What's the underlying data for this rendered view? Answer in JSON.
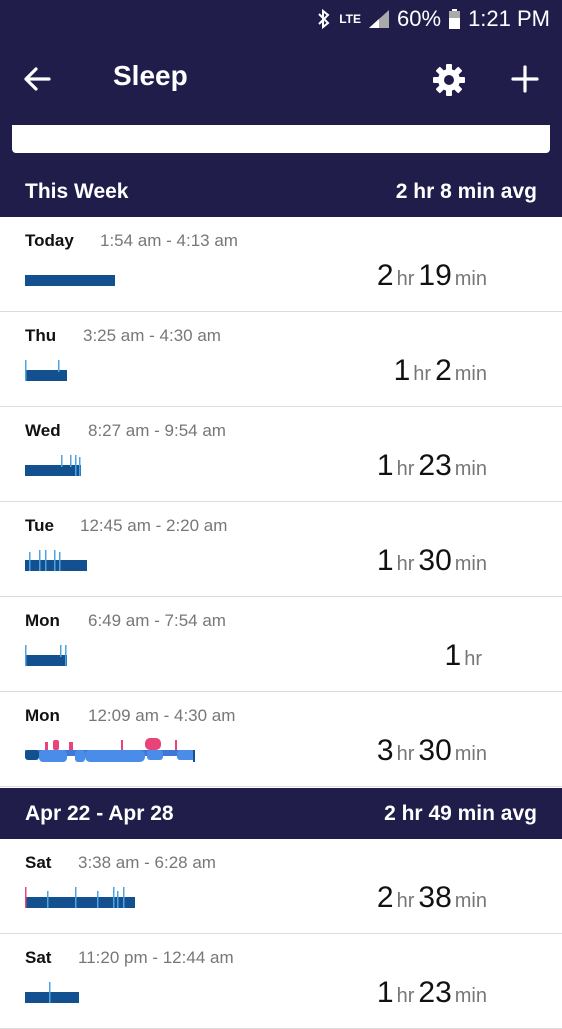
{
  "status_bar": {
    "network": "LTE",
    "battery": "60%",
    "clock": "1:21 PM"
  },
  "app_bar": {
    "title": "Sleep"
  },
  "sections": [
    {
      "label": "This Week",
      "avg": "2 hr 8 min avg",
      "rows": [
        {
          "day": "Today",
          "time": "1:54 am - 4:13 am",
          "hr": "2",
          "min": "19"
        },
        {
          "day": "Thu",
          "time": "3:25 am - 4:30 am",
          "hr": "1",
          "min": "2"
        },
        {
          "day": "Wed",
          "time": "8:27 am - 9:54 am",
          "hr": "1",
          "min": "23"
        },
        {
          "day": "Tue",
          "time": "12:45 am - 2:20 am",
          "hr": "1",
          "min": "30"
        },
        {
          "day": "Mon",
          "time": "6:49 am - 7:54 am",
          "hr": "1",
          "min": ""
        },
        {
          "day": "Mon",
          "time": "12:09 am - 4:30 am",
          "hr": "3",
          "min": "30"
        }
      ]
    },
    {
      "label": "Apr 22 - Apr 28",
      "avg": "2 hr 49 min avg",
      "rows": [
        {
          "day": "Sat",
          "time": "3:38 am - 6:28 am",
          "hr": "2",
          "min": "38"
        },
        {
          "day": "Sat",
          "time": "11:20 pm - 12:44 am",
          "hr": "1",
          "min": "23"
        }
      ]
    }
  ],
  "units": {
    "hr": "hr",
    "min": "min"
  },
  "colors": {
    "header_bg": "#211d4b",
    "asleep": "#13508f",
    "restless": "#4fa3e0",
    "awake": "#e8447a",
    "light": "#4a8de8"
  },
  "icons": {
    "back": "arrow-left-icon",
    "settings": "gear-icon",
    "add": "plus-icon",
    "bluetooth": "bluetooth-icon",
    "signal": "signal-icon",
    "battery": "battery-icon"
  }
}
